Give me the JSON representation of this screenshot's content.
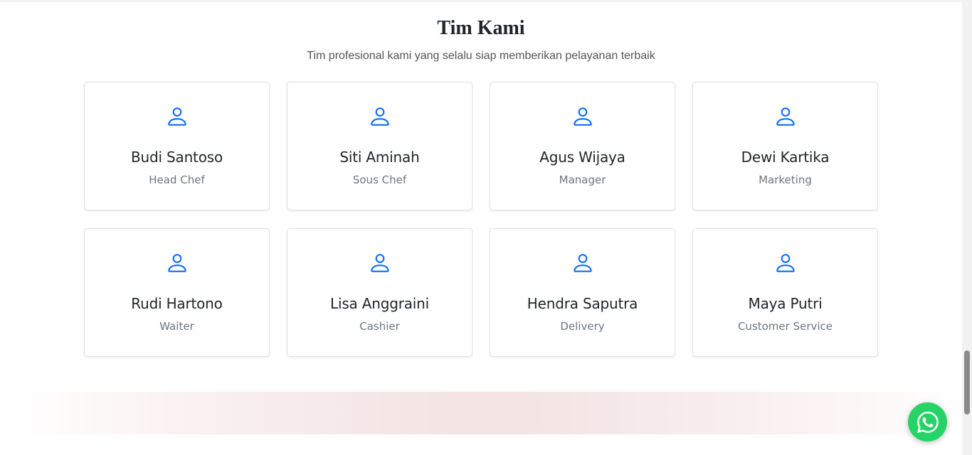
{
  "team": {
    "title": "Tim Kami",
    "subtitle": "Tim profesional kami yang selalu siap memberikan pelayanan terbaik",
    "members": [
      {
        "name": "Budi Santoso",
        "role": "Head Chef",
        "icon": "person-icon"
      },
      {
        "name": "Siti Aminah",
        "role": "Sous Chef",
        "icon": "person-icon"
      },
      {
        "name": "Agus Wijaya",
        "role": "Manager",
        "icon": "person-icon"
      },
      {
        "name": "Dewi Kartika",
        "role": "Marketing",
        "icon": "person-icon"
      },
      {
        "name": "Rudi Hartono",
        "role": "Waiter",
        "icon": "person-icon"
      },
      {
        "name": "Lisa Anggraini",
        "role": "Cashier",
        "icon": "person-icon"
      },
      {
        "name": "Hendra Saputra",
        "role": "Delivery",
        "icon": "person-icon"
      },
      {
        "name": "Maya Putri",
        "role": "Customer Service",
        "icon": "person-icon"
      }
    ]
  },
  "colors": {
    "accent": "#0d6efd",
    "whatsapp": "#25d366",
    "text": "#212529",
    "muted": "#6c757d"
  },
  "floating": {
    "whatsapp_icon": "whatsapp-icon"
  }
}
